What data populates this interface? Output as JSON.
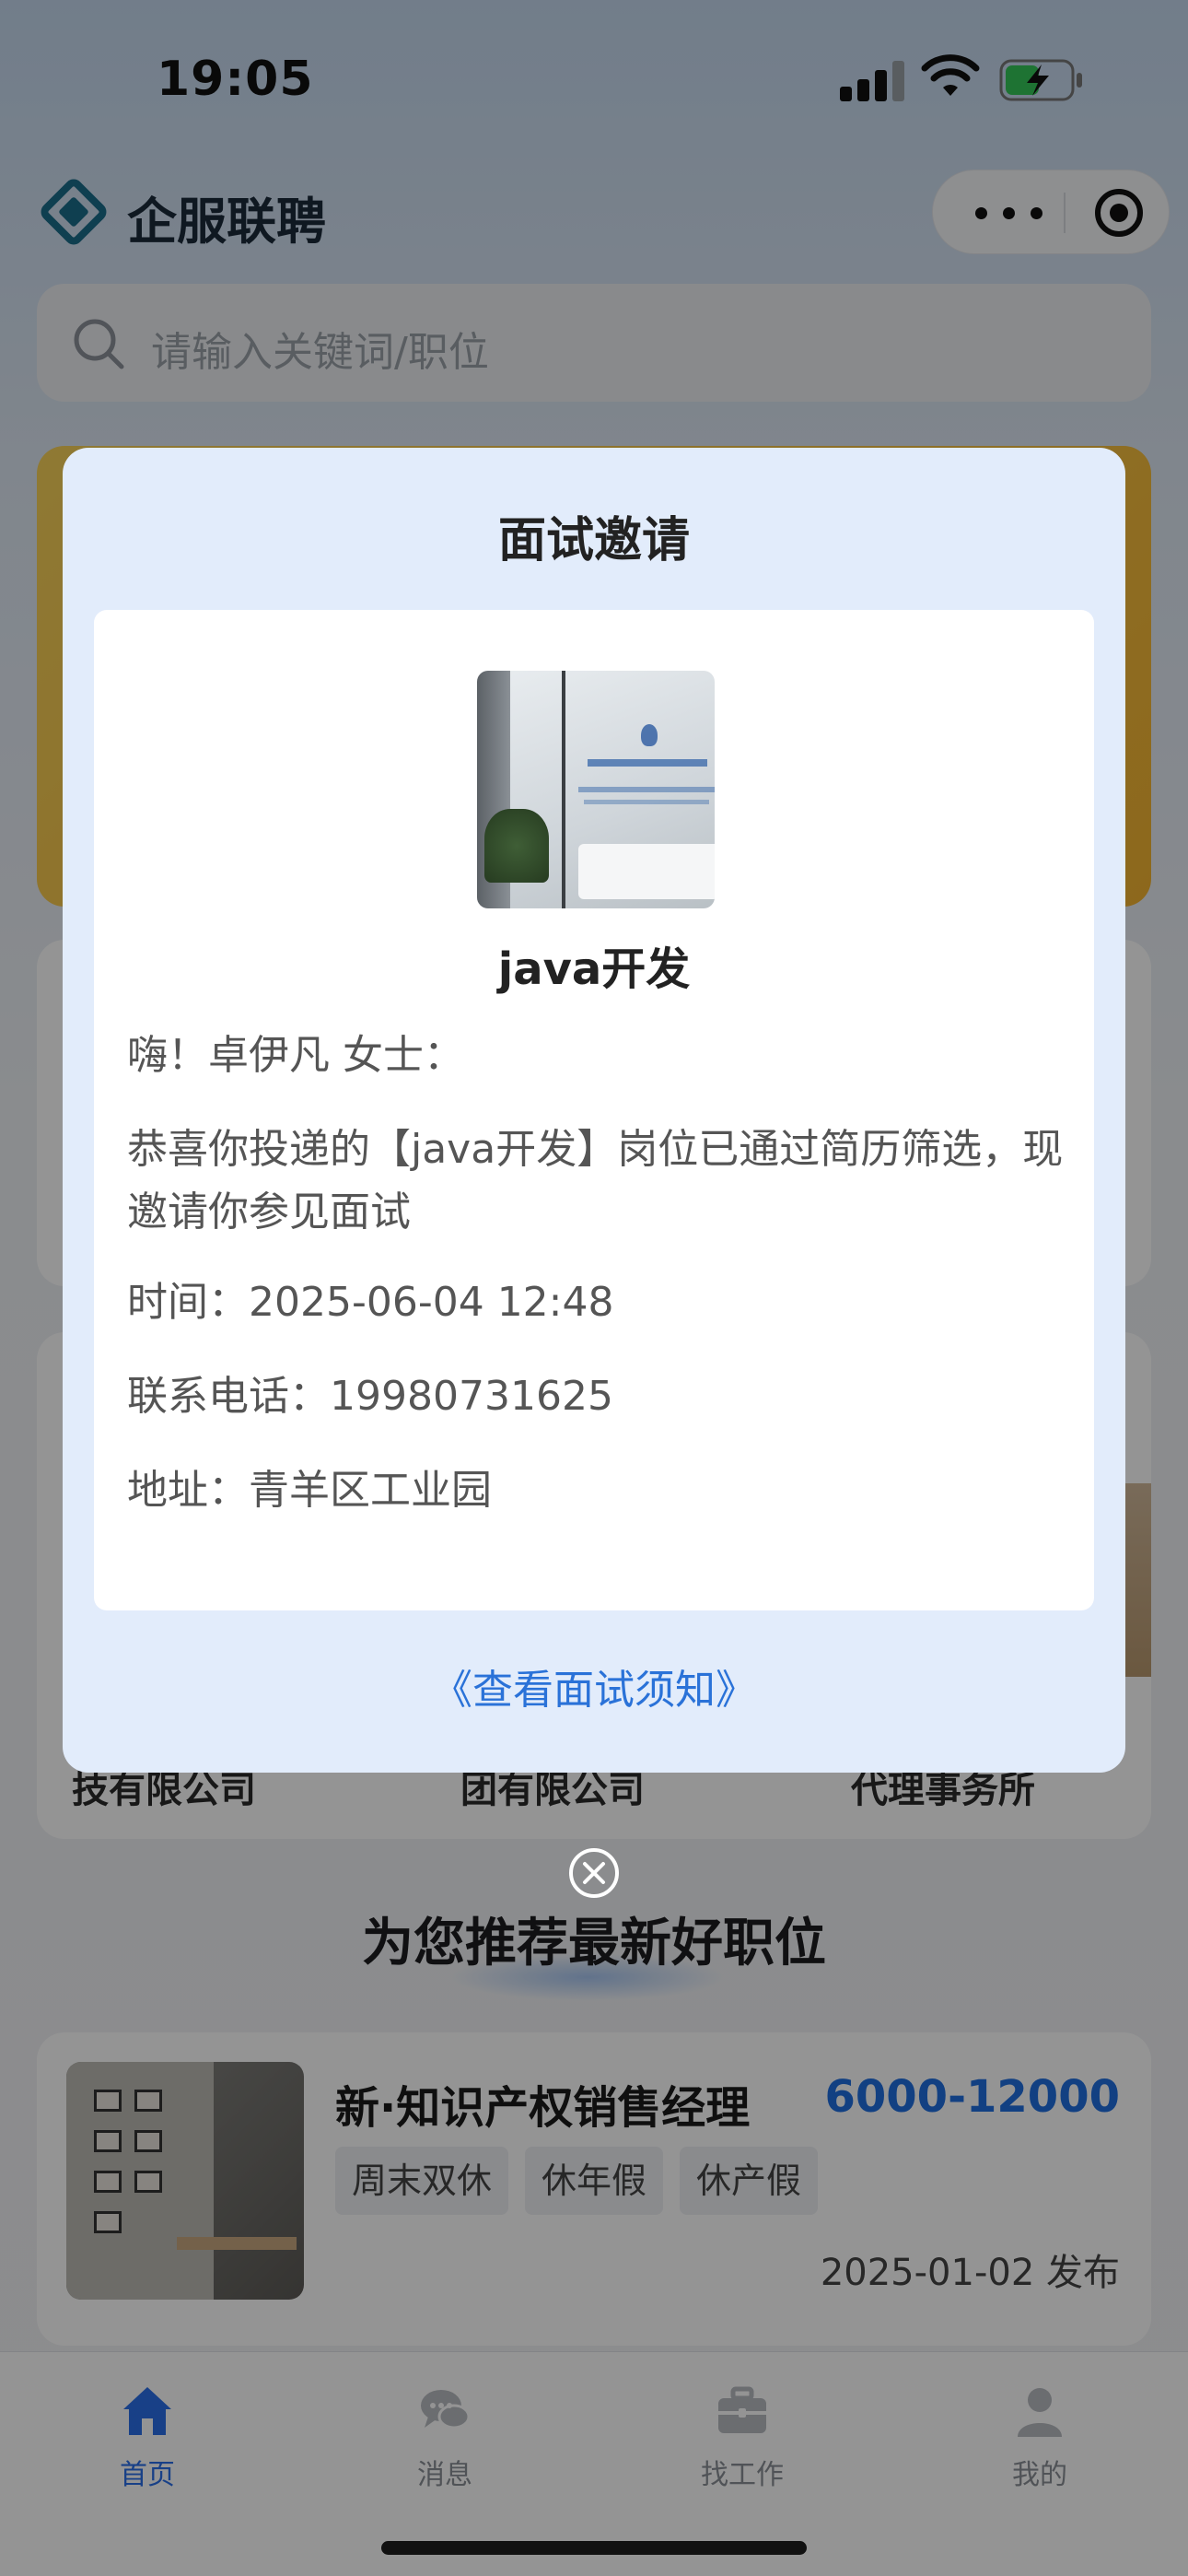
{
  "status_bar": {
    "time": "19:05"
  },
  "header": {
    "app_title": "企服联聘"
  },
  "search": {
    "placeholder": "请输入关键词/职位"
  },
  "companies": [
    "技有限公司",
    "团有限公司",
    "代理事务所"
  ],
  "section": {
    "recommend_title": "为您推荐最新好职位"
  },
  "job": {
    "title": "新·知识产权销售经理",
    "salary": "6000-12000",
    "tags": [
      "周末双休",
      "休年假",
      "休产假"
    ],
    "date": "2025-01-02 发布"
  },
  "tabs": [
    {
      "label": "首页",
      "icon": "home-icon",
      "active": true
    },
    {
      "label": "消息",
      "icon": "chat-icon",
      "active": false
    },
    {
      "label": "找工作",
      "icon": "briefcase-icon",
      "active": false
    },
    {
      "label": "我的",
      "icon": "person-icon",
      "active": false
    }
  ],
  "modal": {
    "title": "面试邀请",
    "job_name": "java开发",
    "greeting": "嗨！卓伊凡 女士：",
    "message": "恭喜你投递的【java开发】岗位已通过简历筛选，现邀请你参见面试",
    "time": "时间：2025-06-04 12:48",
    "phone": "联系电话：19980731625",
    "address": "地址：青羊区工业园",
    "notice_link": "《查看面试须知》"
  },
  "colors": {
    "accent": "#2a72d8",
    "salary": "#1f6fe0",
    "modal_bg": "#e2ecfb",
    "banner": "#f3b431"
  }
}
